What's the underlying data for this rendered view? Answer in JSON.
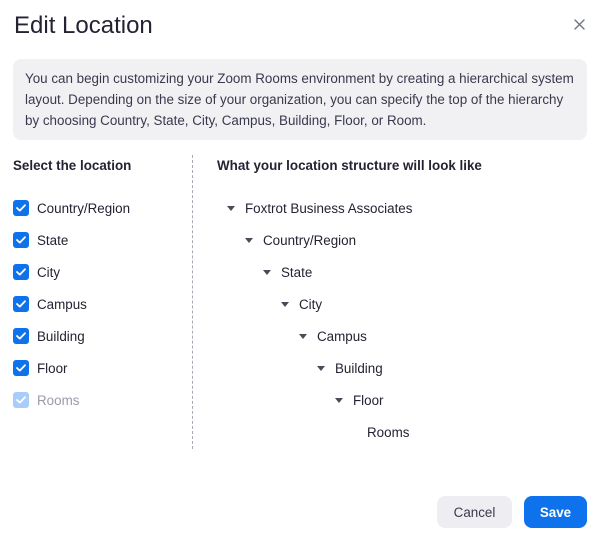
{
  "dialog": {
    "title": "Edit Location",
    "close_icon": "close-icon"
  },
  "info": {
    "text": "You can begin customizing your Zoom Rooms environment by creating a hierarchical system layout. Depending on the size of your organization, you can specify the top of the hierarchy by choosing Country, State, City, Campus, Building, Floor, or Room."
  },
  "left": {
    "heading": "Select the location",
    "items": [
      {
        "label": "Country/Region",
        "checked": true,
        "disabled": false
      },
      {
        "label": "State",
        "checked": true,
        "disabled": false
      },
      {
        "label": "City",
        "checked": true,
        "disabled": false
      },
      {
        "label": "Campus",
        "checked": true,
        "disabled": false
      },
      {
        "label": "Building",
        "checked": true,
        "disabled": false
      },
      {
        "label": "Floor",
        "checked": true,
        "disabled": false
      },
      {
        "label": "Rooms",
        "checked": true,
        "disabled": true
      }
    ]
  },
  "right": {
    "heading": "What your location structure will look like",
    "tree": [
      {
        "label": "Foxtrot Business Associates",
        "expanded": true
      },
      {
        "label": "Country/Region",
        "expanded": true
      },
      {
        "label": "State",
        "expanded": true
      },
      {
        "label": "City",
        "expanded": true
      },
      {
        "label": "Campus",
        "expanded": true
      },
      {
        "label": "Building",
        "expanded": true
      },
      {
        "label": "Floor",
        "expanded": true
      },
      {
        "label": "Rooms",
        "expanded": false
      }
    ]
  },
  "footer": {
    "cancel_label": "Cancel",
    "save_label": "Save"
  },
  "colors": {
    "accent": "#0e72ed",
    "accent_disabled": "#a8cdf8",
    "info_bg": "#f1f1f4"
  }
}
